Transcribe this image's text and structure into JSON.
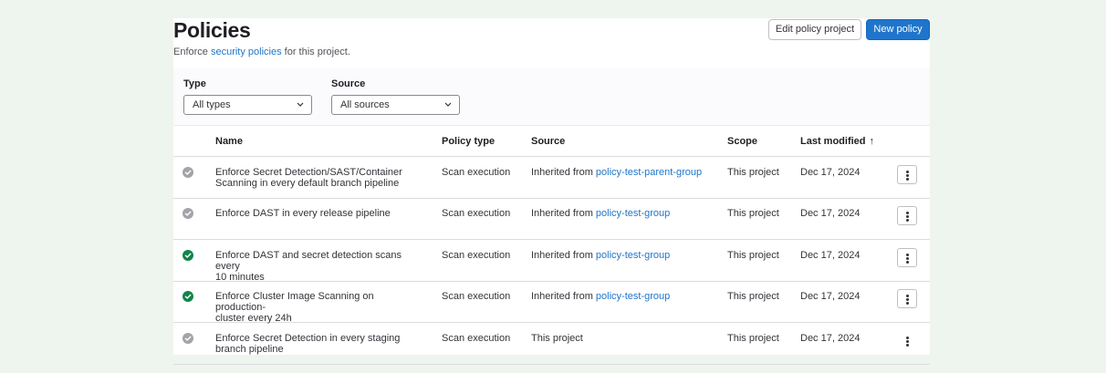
{
  "header": {
    "title": "Policies",
    "subtitle_prefix": "Enforce ",
    "subtitle_link": "security policies",
    "subtitle_suffix": " for this project.",
    "edit_button": "Edit policy project",
    "new_button": "New policy"
  },
  "filters": {
    "type_label": "Type",
    "type_value": "All types",
    "source_label": "Source",
    "source_value": "All sources"
  },
  "table": {
    "columns": [
      "Name",
      "Policy type",
      "Source",
      "Scope",
      "Last modified"
    ],
    "sort_indicator": "↑",
    "rows": [
      {
        "status": "disabled",
        "name_line1": "Enforce Secret Detection/SAST/Container",
        "name_line2": "Scanning in every default branch pipeline",
        "type": "Scan execution",
        "source_prefix": "Inherited from ",
        "source_link": "policy-test-parent-group",
        "scope": "This project",
        "date": "Dec 17, 2024"
      },
      {
        "status": "disabled",
        "name_line1": "Enforce DAST in every release pipeline",
        "name_line2": "",
        "type": "Scan execution",
        "source_prefix": "Inherited from ",
        "source_link": "policy-test-group",
        "scope": "This project",
        "date": "Dec 17, 2024"
      },
      {
        "status": "enabled",
        "name_line1": "Enforce DAST and secret detection scans every",
        "name_line2": "10 minutes",
        "type": "Scan execution",
        "source_prefix": "Inherited from ",
        "source_link": "policy-test-group",
        "scope": "This project",
        "date": "Dec 17, 2024"
      },
      {
        "status": "enabled",
        "name_line1": "Enforce Cluster Image Scanning on production-",
        "name_line2": "cluster every 24h",
        "type": "Scan execution",
        "source_prefix": "Inherited from ",
        "source_link": "policy-test-group",
        "scope": "This project",
        "date": "Dec 17, 2024"
      },
      {
        "status": "disabled",
        "name_line1": "Enforce Secret Detection in every staging",
        "name_line2": "branch pipeline",
        "type": "Scan execution",
        "source_prefix": "This project",
        "source_link": "",
        "scope": "This project",
        "date": "Dec 17, 2024"
      }
    ]
  },
  "colors": {
    "enabled": "#108548",
    "disabled": "#a4a3a8",
    "link": "#1f75cb",
    "primary_button": "#1f75cb",
    "page_background": "#eef5ee"
  },
  "icons": {
    "enabled": "check-circle-icon",
    "disabled": "check-circle-dashed-icon",
    "actions": "ellipsis-v-icon",
    "dropdown": "chevron-down-icon",
    "sort": "arrow-up-icon"
  }
}
